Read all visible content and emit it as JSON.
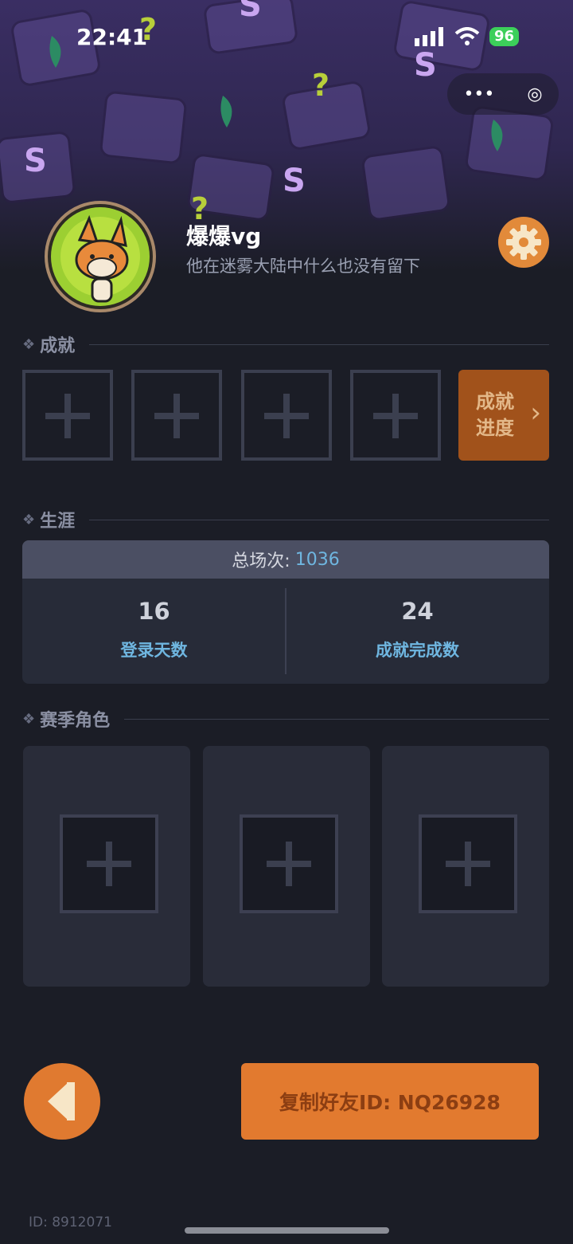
{
  "status": {
    "time": "22:41",
    "battery": "96"
  },
  "capsule": {
    "more_glyph": "•••",
    "close_glyph": "◎"
  },
  "profile": {
    "username": "爆爆vg",
    "bio": "他在迷雾大陆中什么也没有留下"
  },
  "achievements": {
    "title": "成就",
    "slots": 4,
    "progress_label": "成就进度",
    "progress_arrow": "›"
  },
  "career": {
    "title": "生涯",
    "total_label": "总场次:",
    "total_value": "1036",
    "stats": [
      {
        "value": "16",
        "label": "登录天数"
      },
      {
        "value": "24",
        "label": "成就完成数"
      }
    ]
  },
  "season_roles": {
    "title": "赛季角色",
    "slots": 3
  },
  "actions": {
    "back_glyph": "◀",
    "copy_label": "复制好友ID: NQ26928"
  },
  "footer": {
    "id_text": "ID: 8912071"
  },
  "colors": {
    "accent": "#e27a2f",
    "link": "#6fb6e0",
    "background": "#1b1d26"
  },
  "icons": [
    "settings-gear-icon",
    "back-arrow-icon",
    "plus-icon",
    "diamond-bullet-icon",
    "wifi-icon",
    "signal-icon",
    "battery-icon"
  ]
}
